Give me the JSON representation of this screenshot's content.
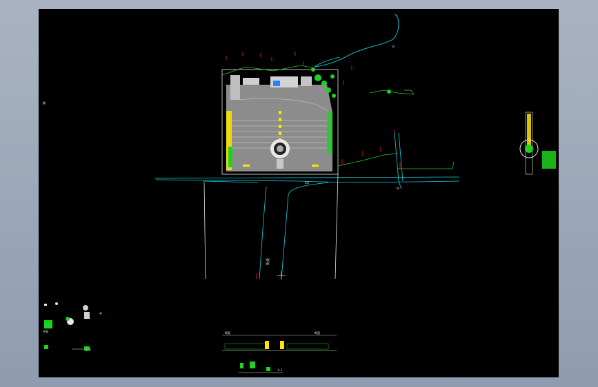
{
  "viewer": {
    "background": "#9aa6b8",
    "canvas_color": "#000000"
  },
  "drawing": {
    "colors": {
      "road": "#19d3e6",
      "boundary": "#e8e8e8",
      "plaza": "#8c8c8c",
      "accent": "#ffe600",
      "green": "#1fd21f",
      "red": "#ff2020",
      "blue": "#2a7fff"
    },
    "labels": {
      "river_label": "河",
      "west_note": "路",
      "road_label_mid": "15",
      "road_label_vertical": "街道",
      "road_label_east": "18",
      "section_label_a": "断面",
      "section_label_b": "断面",
      "scale_note_1": "1:1",
      "scale_note_2": "1:1",
      "legend_note": "平面"
    }
  }
}
